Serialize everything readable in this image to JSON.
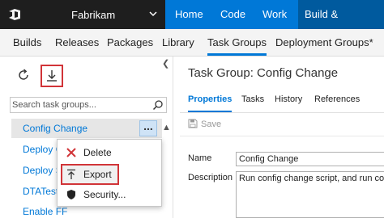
{
  "topbar": {
    "logo_icon": "vsts-logo-icon",
    "account": "Fabrikam",
    "nav": [
      "Home",
      "Code",
      "Work",
      "Build & Release"
    ],
    "active_nav": "Build & Release"
  },
  "subtabs": [
    "Builds",
    "Releases",
    "Packages",
    "Library",
    "Task Groups",
    "Deployment Groups*"
  ],
  "active_subtab": "Task Groups",
  "leftpane": {
    "search_placeholder": "Search task groups...",
    "items": [
      "Config Change",
      "Deploy C",
      "Deploy S",
      "DTATest",
      "Enable FF"
    ],
    "ellipsis": "...",
    "menu": [
      {
        "label": "Delete",
        "icon": "close-icon"
      },
      {
        "label": "Export",
        "icon": "export-icon"
      },
      {
        "label": "Security...",
        "icon": "shield-icon"
      }
    ]
  },
  "details": {
    "title": "Task Group: Config Change",
    "tabs": [
      "Properties",
      "Tasks",
      "History",
      "References"
    ],
    "active_tab": "Properties",
    "save_label": "Save",
    "name_label": "Name",
    "name_value": "Config Change",
    "description_label": "Description",
    "description_value": "Run config change script, and run confi"
  },
  "colors": {
    "accent": "#0078d7",
    "highlight_box": "#d13438",
    "account_bg": "#1e1e1e"
  }
}
